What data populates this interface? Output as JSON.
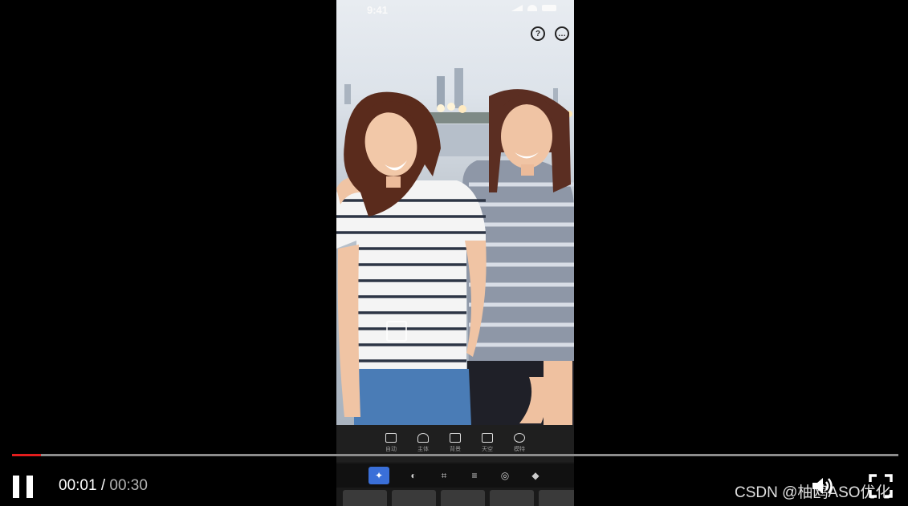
{
  "phone": {
    "status_time": "9:41",
    "icons": {
      "help": "help-icon",
      "more": "more-icon"
    },
    "tools_primary": [
      {
        "label": "自动",
        "icon": "auto-cutout-icon"
      },
      {
        "label": "主体",
        "icon": "subject-icon"
      },
      {
        "label": "背景",
        "icon": "background-icon"
      },
      {
        "label": "天空",
        "icon": "sky-icon"
      },
      {
        "label": "模特",
        "icon": "model-icon"
      }
    ],
    "tools_secondary": [
      {
        "icon": "magic-wand-icon",
        "active": true
      },
      {
        "icon": "layers-icon"
      },
      {
        "icon": "crop-icon"
      },
      {
        "icon": "sliders-icon"
      },
      {
        "icon": "blur-icon"
      },
      {
        "icon": "eraser-icon"
      }
    ]
  },
  "player": {
    "current_time": "00:01",
    "separator": "/",
    "duration": "00:30",
    "progress_fraction": 0.033,
    "progress_color": "#e31d1d",
    "watermark": "CSDN @柚鸥ASO优化"
  }
}
